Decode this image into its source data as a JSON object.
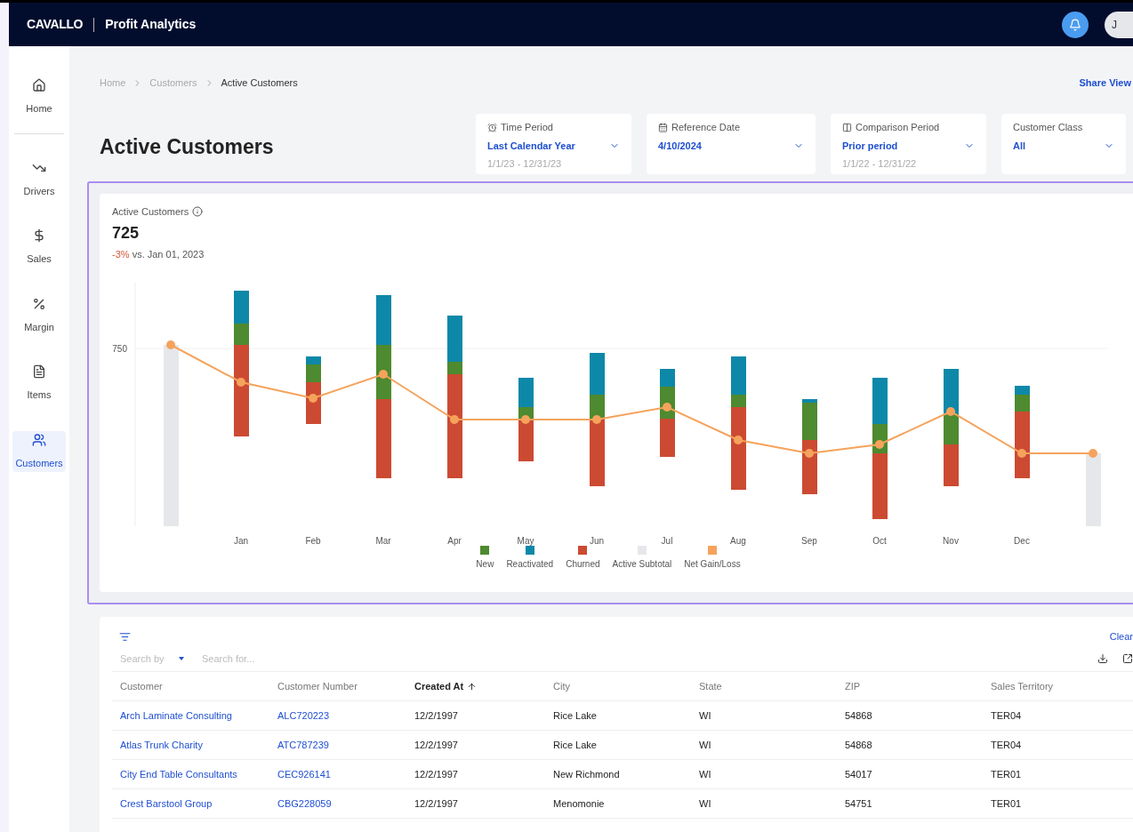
{
  "header": {
    "brand": "CAVALLO",
    "app_title": "Profit Analytics",
    "avatar_initial": "J"
  },
  "sidebar": {
    "items": [
      {
        "label": "Home",
        "selected": false
      },
      {
        "label": "Drivers",
        "selected": false
      },
      {
        "label": "Sales",
        "selected": false
      },
      {
        "label": "Margin",
        "selected": false
      },
      {
        "label": "Items",
        "selected": false
      },
      {
        "label": "Customers",
        "selected": true
      }
    ]
  },
  "breadcrumb": [
    "Home",
    "Customers",
    "Active Customers"
  ],
  "share_link": "Share View",
  "page_title": "Active Customers",
  "filters": [
    {
      "label": "Time Period",
      "value": "Last Calendar Year",
      "range": "1/1/23 - 12/31/23"
    },
    {
      "label": "Reference Date",
      "value": "4/10/2024"
    },
    {
      "label": "Comparison Period",
      "value": "Prior period",
      "range": "1/1/22 - 12/31/22"
    },
    {
      "label": "Customer Class",
      "value": "All"
    }
  ],
  "metric": {
    "title": "Active Customers",
    "value": "725",
    "change": "-3%",
    "change_suffix": "vs. Jan 01, 2023"
  },
  "chart": {
    "y_tick_label": "750",
    "x_labels": [
      "Jan",
      "Feb",
      "Mar",
      "Apr",
      "May",
      "Jun",
      "Jul",
      "Aug",
      "Sep",
      "Oct",
      "Nov",
      "Dec"
    ],
    "legend": [
      {
        "label": "New",
        "color": "#4e8a2f"
      },
      {
        "label": "Reactivated",
        "color": "#0e88a8"
      },
      {
        "label": "Churned",
        "color": "#cc4a32"
      },
      {
        "label": "Active Subtotal",
        "color": "#e5e7eb"
      },
      {
        "label": "Net Gain/Loss",
        "color": "#f5a35c"
      }
    ]
  },
  "table": {
    "clear_label": "Clear",
    "search_by_placeholder": "Search by",
    "search_placeholder": "Search for...",
    "columns": [
      {
        "label": "Customer",
        "sorted": false
      },
      {
        "label": "Customer Number",
        "sorted": false
      },
      {
        "label": "Created At",
        "sorted": true
      },
      {
        "label": "City",
        "sorted": false
      },
      {
        "label": "State",
        "sorted": false
      },
      {
        "label": "ZIP",
        "sorted": false
      },
      {
        "label": "Sales Territory",
        "sorted": false
      }
    ],
    "rows": [
      [
        "Arch Laminate Consulting",
        "ALC720223",
        "12/2/1997",
        "Rice Lake",
        "WI",
        "54868",
        "TER04"
      ],
      [
        "Atlas Trunk Charity",
        "ATC787239",
        "12/2/1997",
        "Rice Lake",
        "WI",
        "54868",
        "TER04"
      ],
      [
        "City End Table Consultants",
        "CEC926141",
        "12/2/1997",
        "New Richmond",
        "WI",
        "54017",
        "TER01"
      ],
      [
        "Crest Barstool Group",
        "CBG228059",
        "12/2/1997",
        "Menomonie",
        "WI",
        "54751",
        "TER01"
      ]
    ]
  }
}
